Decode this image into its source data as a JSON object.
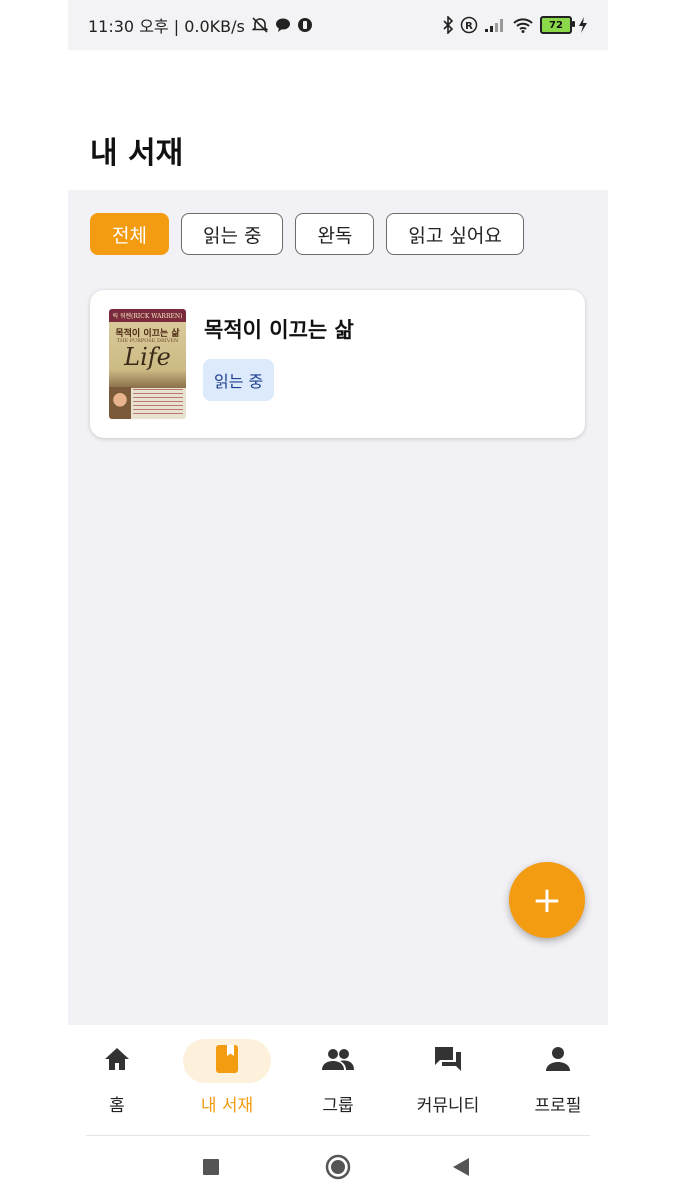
{
  "status_bar": {
    "time_info": "11:30 오후 | 0.0KB/s",
    "battery": "72"
  },
  "header": {
    "title": "내 서재"
  },
  "filters": [
    {
      "label": "전체",
      "active": true
    },
    {
      "label": "읽는 중",
      "active": false
    },
    {
      "label": "완독",
      "active": false
    },
    {
      "label": "읽고 싶어요",
      "active": false
    }
  ],
  "books": [
    {
      "title": "목적이 이끄는 삶",
      "status": "읽는 중",
      "cover": {
        "author_line": "릭 워렌(RICK WARREN)",
        "title": "목적이 이끄는 삶",
        "subtitle": "THE PURPOSE DRIVEN",
        "word": "Life"
      }
    }
  ],
  "fab": {
    "icon": "plus-icon",
    "label": "+"
  },
  "bottom_nav": [
    {
      "label": "홈",
      "icon": "home-icon",
      "active": false
    },
    {
      "label": "내 서재",
      "icon": "book-icon",
      "active": true
    },
    {
      "label": "그룹",
      "icon": "group-icon",
      "active": false
    },
    {
      "label": "커뮤니티",
      "icon": "forum-icon",
      "active": false
    },
    {
      "label": "프로필",
      "icon": "person-icon",
      "active": false
    }
  ],
  "colors": {
    "accent": "#f39c12",
    "badge_bg": "#dceafc",
    "badge_text": "#1d3f8f",
    "content_bg": "#f2f1f5"
  }
}
